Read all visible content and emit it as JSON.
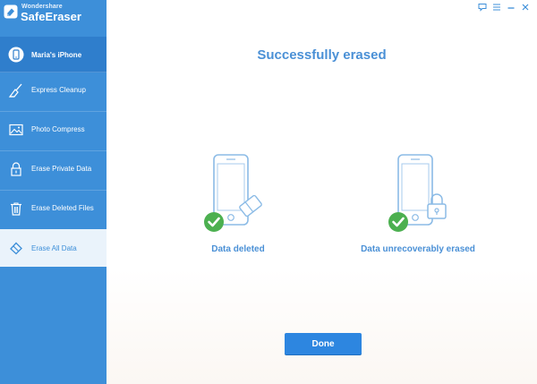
{
  "brand": {
    "small": "Wondershare",
    "big": "SafeEraser"
  },
  "sidebar": {
    "device": "Maria's iPhone",
    "items": [
      {
        "label": "Express Cleanup",
        "icon": "broom-icon"
      },
      {
        "label": "Photo Compress",
        "icon": "photo-icon"
      },
      {
        "label": "Erase Private Data",
        "icon": "lock-icon"
      },
      {
        "label": "Erase Deleted Files",
        "icon": "trash-icon"
      },
      {
        "label": "Erase All Data",
        "icon": "eraser-icon",
        "selected": true
      }
    ]
  },
  "main": {
    "title": "Successfully erased",
    "results": [
      {
        "label": "Data deleted",
        "icon": "phone-eraser-icon"
      },
      {
        "label": "Data unrecoverably erased",
        "icon": "phone-lock-icon"
      }
    ],
    "done_label": "Done"
  },
  "colors": {
    "sidebar": "#3d8fd9",
    "sidebar_active": "#2f7ecc",
    "accent": "#4a90d6",
    "check": "#4cb050",
    "button": "#2d86e0"
  }
}
